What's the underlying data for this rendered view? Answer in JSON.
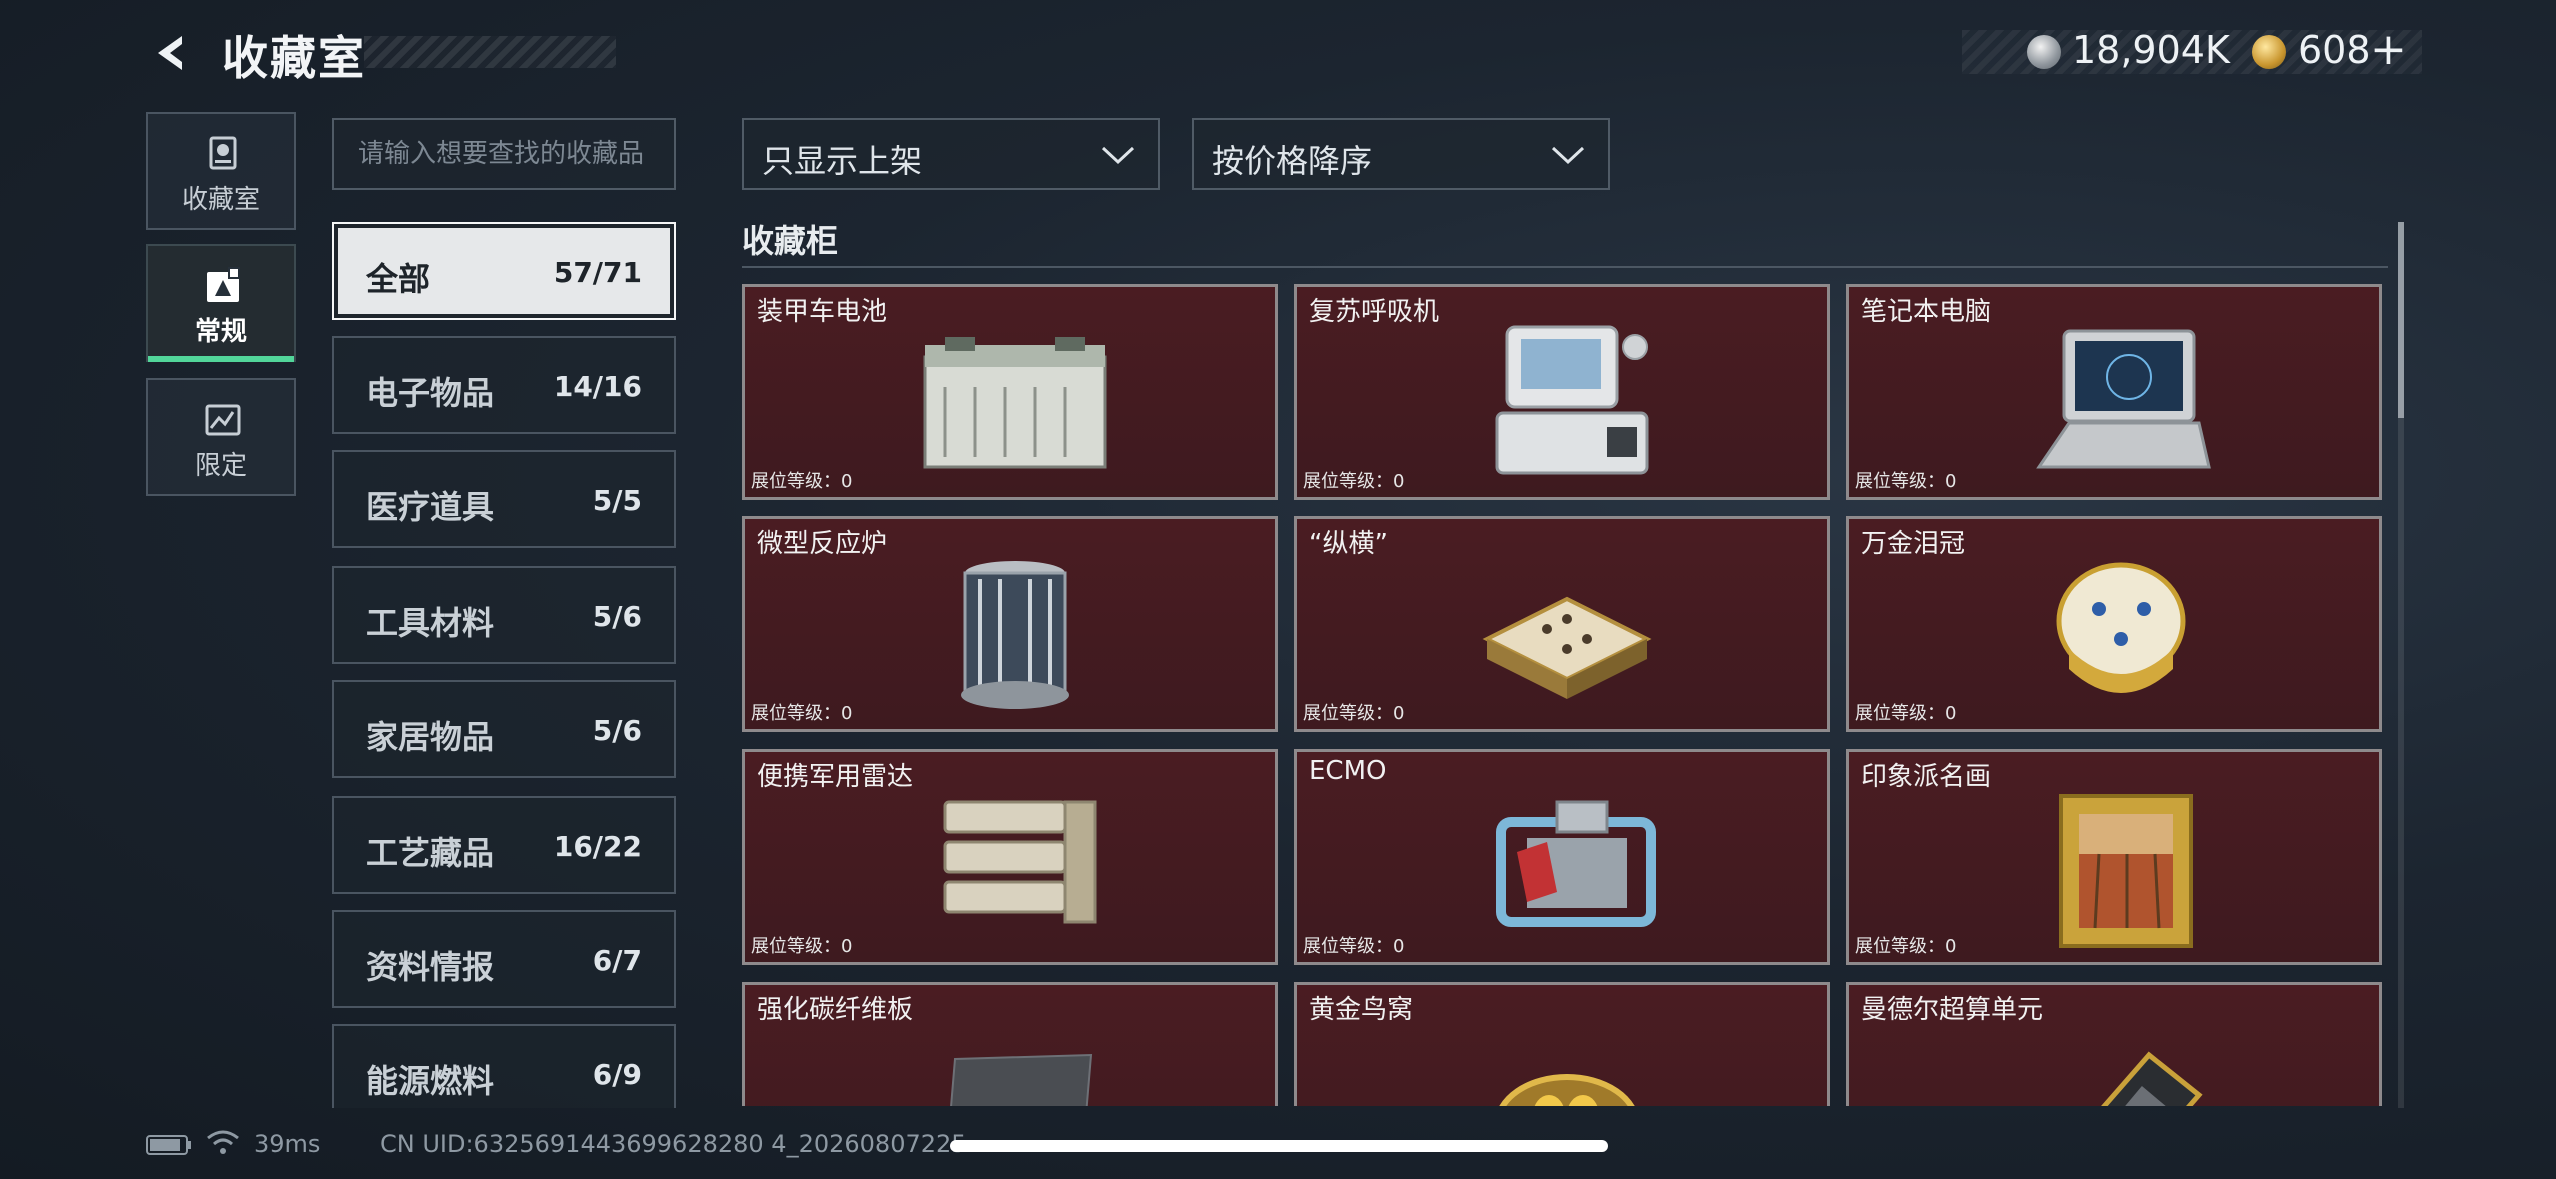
{
  "header": {
    "title": "收藏室",
    "currency_silver": "18,904K",
    "currency_gold": "608",
    "gold_plus": "+"
  },
  "nav": {
    "tabs": [
      {
        "label": "收藏室",
        "icon": "trophy-icon",
        "active": false
      },
      {
        "label": "常规",
        "icon": "collection-icon",
        "active": true
      },
      {
        "label": "限定",
        "icon": "limited-icon",
        "active": false
      }
    ]
  },
  "search": {
    "placeholder": "请输入想要查找的收藏品",
    "value": ""
  },
  "categories": [
    {
      "name": "全部",
      "count": "57/71",
      "active": true
    },
    {
      "name": "电子物品",
      "count": "14/16"
    },
    {
      "name": "医疗道具",
      "count": "5/5"
    },
    {
      "name": "工具材料",
      "count": "5/6"
    },
    {
      "name": "家居物品",
      "count": "5/6"
    },
    {
      "name": "工艺藏品",
      "count": "16/22"
    },
    {
      "name": "资料情报",
      "count": "6/7"
    },
    {
      "name": "能源燃料",
      "count": "6/9"
    }
  ],
  "filters": {
    "listing": "只显示上架",
    "sort": "按价格降序"
  },
  "section": {
    "title": "收藏柜"
  },
  "items": [
    {
      "name": "装甲车电池",
      "level": "展位等级：0",
      "icon": "battery-item-icon"
    },
    {
      "name": "复苏呼吸机",
      "level": "展位等级：0",
      "icon": "ventilator-item-icon"
    },
    {
      "name": "笔记本电脑",
      "level": "展位等级：0",
      "icon": "laptop-item-icon"
    },
    {
      "name": "微型反应炉",
      "level": "展位等级：0",
      "icon": "reactor-item-icon"
    },
    {
      "name": "“纵横”",
      "level": "展位等级：0",
      "icon": "chessboard-item-icon"
    },
    {
      "name": "万金泪冠",
      "level": "展位等级：0",
      "icon": "jeweled-egg-item-icon"
    },
    {
      "name": "便携军用雷达",
      "level": "展位等级：0",
      "icon": "radar-item-icon"
    },
    {
      "name": "ECMO",
      "level": "展位等级：0",
      "icon": "ecmo-item-icon"
    },
    {
      "name": "印象派名画",
      "level": "展位等级：0",
      "icon": "painting-item-icon"
    },
    {
      "name": "强化碳纤维板",
      "level": "",
      "icon": "carbon-plate-item-icon"
    },
    {
      "name": "黄金鸟窝",
      "level": "",
      "icon": "golden-nest-item-icon"
    },
    {
      "name": "曼德尔超算单元",
      "level": "",
      "icon": "compute-unit-item-icon"
    }
  ],
  "status": {
    "ping": "39ms",
    "uid": "CN UID:6325691443699628280 4_20260807225"
  },
  "colors": {
    "accent_green": "#52d69a",
    "card_bg": "#4a1c22",
    "background": "#1c2530"
  }
}
